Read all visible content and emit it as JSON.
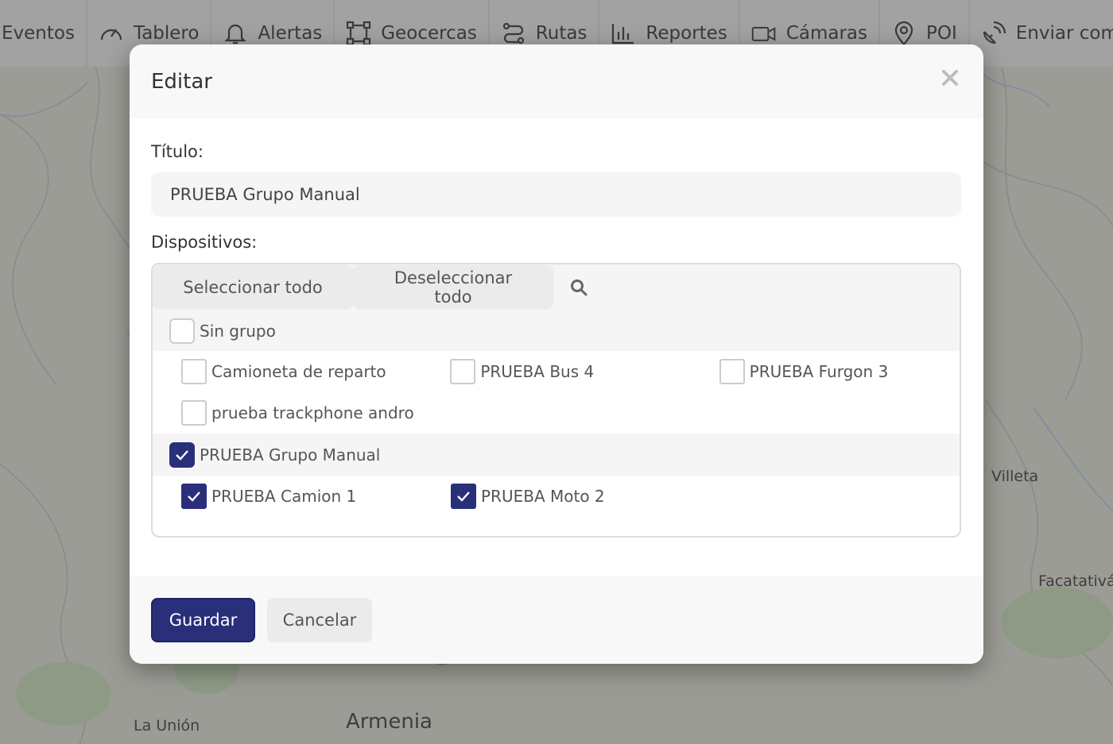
{
  "nav": {
    "items": [
      {
        "label": "Eventos",
        "icon": "none"
      },
      {
        "label": "Tablero",
        "icon": "gauge-icon"
      },
      {
        "label": "Alertas",
        "icon": "bell-icon"
      },
      {
        "label": "Geocercas",
        "icon": "geofence-icon"
      },
      {
        "label": "Rutas",
        "icon": "route-icon"
      },
      {
        "label": "Reportes",
        "icon": "bar-chart-icon"
      },
      {
        "label": "Cámaras",
        "icon": "camera-icon"
      },
      {
        "label": "POI",
        "icon": "map-pin-icon"
      },
      {
        "label": "Enviar comand",
        "icon": "satellite-icon"
      }
    ]
  },
  "map": {
    "labels": {
      "villeta": "Villeta",
      "facatativa": "Facatativá",
      "armenia": "Armenia",
      "launion": "La Unión"
    }
  },
  "modal": {
    "title": "Editar",
    "close_icon": "close-icon",
    "title_label": "Título:",
    "title_value": "PRUEBA Grupo Manual",
    "devices_label": "Dispositivos:",
    "select_all": "Seleccionar todo",
    "deselect_all": "Deseleccionar todo",
    "groups": [
      {
        "name": "Sin grupo",
        "checked": false,
        "devices": [
          {
            "name": "Camioneta de reparto",
            "checked": false
          },
          {
            "name": "PRUEBA Bus 4",
            "checked": false
          },
          {
            "name": "PRUEBA Furgon 3",
            "checked": false
          },
          {
            "name": "prueba trackphone andro",
            "checked": false
          }
        ]
      },
      {
        "name": "PRUEBA Grupo Manual",
        "checked": true,
        "devices": [
          {
            "name": "PRUEBA Camion 1",
            "checked": true
          },
          {
            "name": "PRUEBA Moto 2",
            "checked": true
          }
        ]
      }
    ],
    "save_label": "Guardar",
    "cancel_label": "Cancelar"
  },
  "colors": {
    "primary": "#2a2f7a",
    "nav_bg": "#a2a2a2",
    "map_bg": "#9c9c96"
  }
}
